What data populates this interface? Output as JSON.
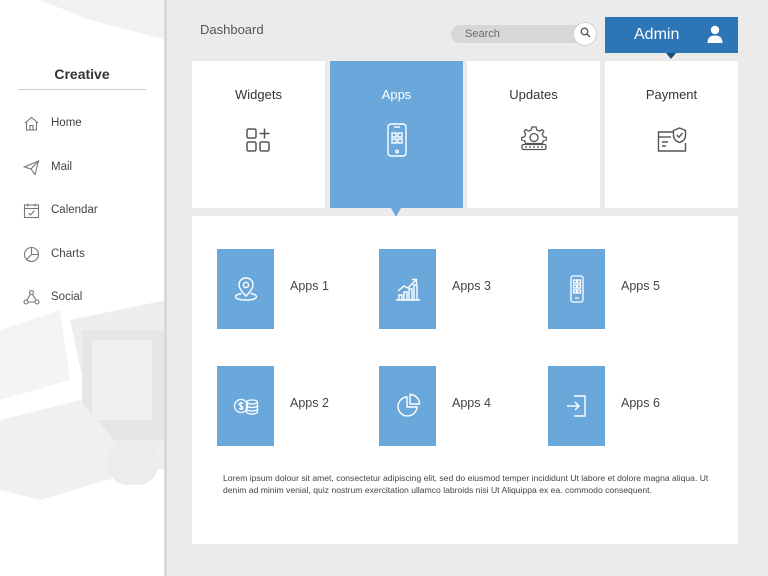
{
  "sidebar": {
    "brand": "Creative",
    "items": [
      {
        "label": "Home",
        "icon": "home-icon"
      },
      {
        "label": "Mail",
        "icon": "send-icon"
      },
      {
        "label": "Calendar",
        "icon": "calendar-icon"
      },
      {
        "label": "Charts",
        "icon": "pie-chart-icon"
      },
      {
        "label": "Social",
        "icon": "share-nodes-icon"
      }
    ]
  },
  "header": {
    "title": "Dashboard",
    "search_placeholder": "Search",
    "admin_label": "Admin"
  },
  "cards": [
    {
      "label": "Widgets",
      "icon": "widgets-grid-icon",
      "active": false
    },
    {
      "label": "Apps",
      "icon": "phone-apps-icon",
      "active": true
    },
    {
      "label": "Updates",
      "icon": "gear-update-icon",
      "active": false
    },
    {
      "label": "Payment",
      "icon": "secure-card-icon",
      "active": false
    }
  ],
  "apps": [
    {
      "label": "Apps 1",
      "icon": "location-pin-icon"
    },
    {
      "label": "Apps 3",
      "icon": "growth-chart-icon"
    },
    {
      "label": "Apps 5",
      "icon": "phone-grid-icon"
    },
    {
      "label": "Apps 2",
      "icon": "coins-icon"
    },
    {
      "label": "Apps 4",
      "icon": "pie-chart-icon"
    },
    {
      "label": "Apps 6",
      "icon": "sign-in-icon"
    }
  ],
  "description": "Lorem ipsum dolour sit amet, consectetur adipiscing elit, sed do eiusmod temper incididunt Ut labore et dolore magna aliqua. Ut denim ad minim venial, quiz nostrum exercitation ullamco labroids nisi Ut Aliquippa ex ea. commodo consequent.",
  "colors": {
    "accent": "#6aa8dc",
    "admin": "#2e75b6",
    "background": "#ebebeb"
  }
}
